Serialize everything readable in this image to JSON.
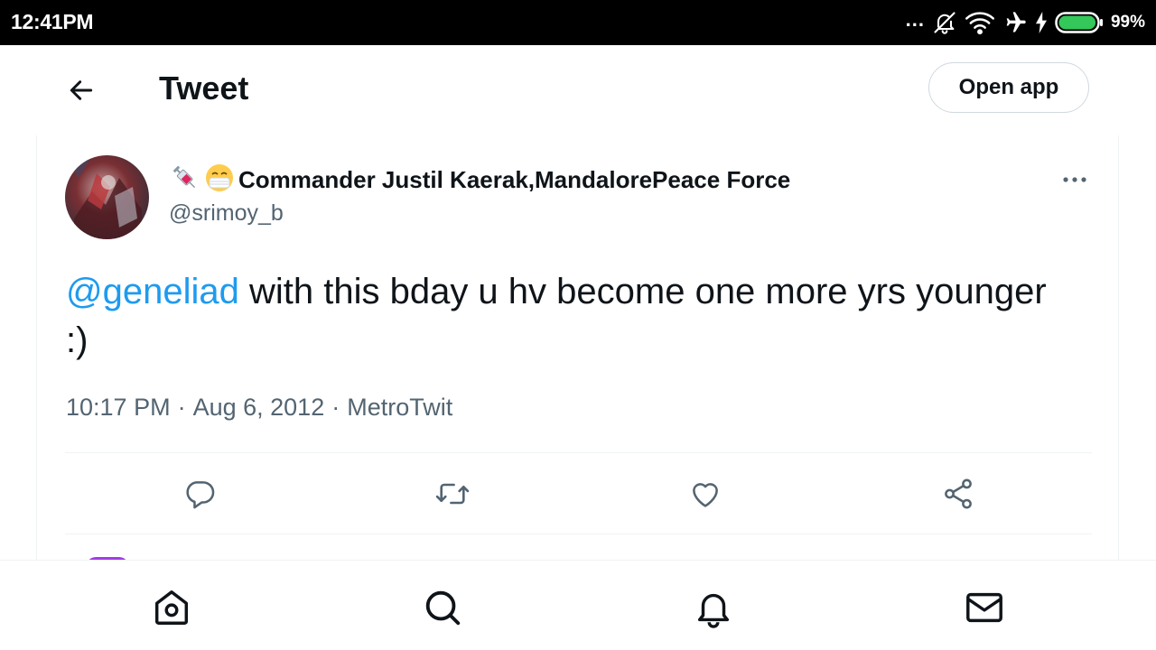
{
  "status_bar": {
    "time": "12:41PM",
    "overflow_dots": "...",
    "battery_percent": "99%",
    "battery_level": 0.99,
    "icons": [
      "notifications-off-icon",
      "wifi-icon",
      "airplane-mode-icon",
      "charging-bolt-icon",
      "battery-icon"
    ]
  },
  "header": {
    "back_icon": "arrow-left-icon",
    "title": "Tweet",
    "open_app_label": "Open app"
  },
  "tweet": {
    "author": {
      "emoji_prefix": "💉😷",
      "display_name": "Commander Justil Kaerak,MandalorePeace Force",
      "handle": "@srimoy_b",
      "avatar_icon": "avatar"
    },
    "more_icon": "more-horizontal-icon",
    "mention": "@geneliad",
    "text_body": " with this bday u hv become one more yrs younger :)",
    "time": "10:17 PM",
    "separator": "·",
    "date": "Aug 6, 2012",
    "source": "MetroTwit",
    "actions": [
      "reply-icon",
      "retweet-icon",
      "like-icon",
      "share-icon"
    ]
  },
  "bottom_nav": [
    "home-icon",
    "search-icon",
    "notifications-icon",
    "messages-icon"
  ],
  "colors": {
    "accent": "#1d9bf0",
    "text_primary": "#0f1419",
    "text_secondary": "#536471",
    "border": "#cfd9de",
    "divider": "#eff3f4",
    "status_bar_bg": "#000000",
    "battery_green": "#34c759",
    "peek_purple": "#a23de6"
  }
}
